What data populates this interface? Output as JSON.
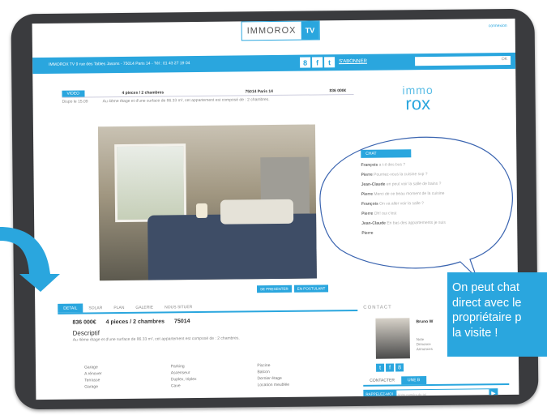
{
  "site": {
    "logo_text": "IMMOROX",
    "logo_tv": "TV",
    "top_link": "connexion",
    "address_bar": "IMMOROX TV 9 rue des Tables Jasons - 75014 Paris 14 - Tél : 01 43 27 19 04",
    "social_icons": [
      "google-plus-icon",
      "facebook-icon",
      "twitter-icon"
    ],
    "abonner_label": "S'ABONNER",
    "search_placeholder": "",
    "search_ok": "OK"
  },
  "property": {
    "tag": "VIDEO",
    "rooms": "4 pieces / 2 chambres",
    "location": "75014 Paris 14",
    "price": "836 000€",
    "sub_label": "Dispo le 15.09",
    "short_desc": "Au 4ème étage et d'une surface de 86.33 m², cet appartement est composé de : 2 chambres."
  },
  "action_buttons": [
    "SE PRESENTER",
    "EN POSTULANT"
  ],
  "tabs": [
    "DETAIL",
    "SOLAR",
    "PLAN",
    "GALERIE",
    "NOUS SITUER"
  ],
  "details": {
    "price": "836 000€",
    "rooms": "4 pieces / 2 chambres",
    "postal": "75014",
    "desc_title": "Descriptif",
    "desc_text": "Au 4ème étage et d'une surface de 86.33 m², cet appartement est composé de : 2 chambres.",
    "features": [
      "Garage",
      "Parking",
      "Piscine",
      "A rénover",
      "Ascenseur",
      "Balcon",
      "Terrasse",
      "Duplex, triplex",
      "Dernier étage",
      "Garage",
      "Cave",
      "Location meublée"
    ]
  },
  "brand": {
    "line1": "immo",
    "line2": "rox"
  },
  "chat": {
    "header": "CHAT",
    "lines": [
      {
        "name": "François",
        "text": "a t-il des bus ?"
      },
      {
        "name": "Pierre",
        "text": "Pourriez-vous la cuisine svp ?"
      },
      {
        "name": "Jean-Claude",
        "text": "en peut voir la salle de bains ?"
      },
      {
        "name": "Pierre",
        "text": "Merci de ce beau moment de la cuisine"
      },
      {
        "name": "François",
        "text": "On va aller voir la salle ?"
      },
      {
        "name": "Pierre",
        "text": "Oh! oui c'est"
      },
      {
        "name": "Jean-Claude",
        "text": "En bas des appartements je suis"
      },
      {
        "name": "Pierre",
        "text": ""
      }
    ]
  },
  "contact": {
    "label": "CONTACT",
    "agent_name": "Bruno W",
    "agent_info": [
      "Note",
      "Dnnonce",
      "Annonces"
    ],
    "tabs": [
      "CONTACTER",
      "UNE B"
    ],
    "callback_label": "RAPPELEZ-MOI",
    "callback_placeholder": "Votre numéro de tel",
    "callback_go": "▶"
  },
  "callout": {
    "line1": "On peut chat",
    "line2": "direct avec le",
    "line3": "propriétaire p",
    "line4": "la visite !"
  },
  "colors": {
    "accent": "#2aa6de",
    "frame": "#3a3b3e"
  }
}
